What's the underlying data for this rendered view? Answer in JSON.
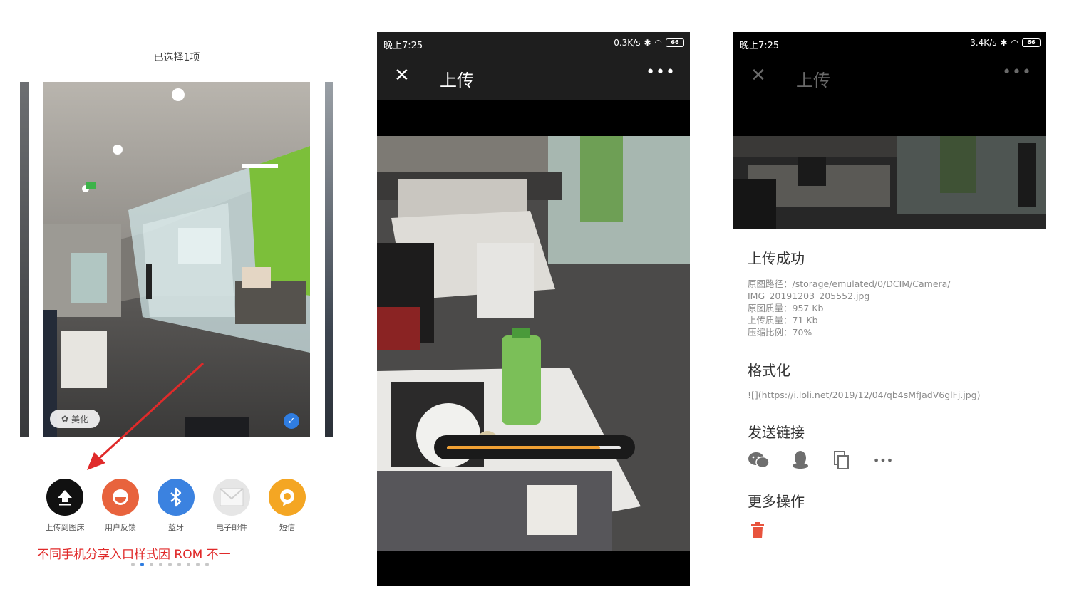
{
  "share_sheet": {
    "title": "已选择1项",
    "beautify_label": "美化",
    "items": [
      {
        "label": "上传到图床",
        "icon": "upload-icon",
        "color": "#111111"
      },
      {
        "label": "用户反馈",
        "icon": "feedback-icon",
        "color": "#e8633d"
      },
      {
        "label": "蓝牙",
        "icon": "bluetooth-icon",
        "color": "#3b82e0"
      },
      {
        "label": "电子邮件",
        "icon": "email-icon",
        "color": "#e6e6e6"
      },
      {
        "label": "短信",
        "icon": "sms-icon",
        "color": "#f4a623"
      }
    ],
    "note": "不同手机分享入口样式因 ROM 不一",
    "page_dots": 9,
    "active_dot": 1
  },
  "upload_screen": {
    "status": {
      "time": "晚上7:25",
      "speed": "0.3K/s",
      "battery": "66"
    },
    "title": "上传",
    "close_icon": "close-icon",
    "more_icon": "more-icon",
    "progress": 0.88,
    "progress_color": "#f0a033"
  },
  "result_screen": {
    "status": {
      "time": "晚上7:25",
      "speed": "3.4K/s",
      "battery": "66"
    },
    "title": "上传",
    "success_title": "上传成功",
    "info": {
      "path_label": "原图路径：",
      "path_value_1": "/storage/emulated/0/DCIM/Camera/",
      "path_value_2": "IMG_20191203_205552.jpg",
      "orig_size": "原图质量：957 Kb",
      "upload_size": "上传质量：71 Kb",
      "ratio": "压缩比例：70%"
    },
    "format_title": "格式化",
    "format_value": "![](https://i.loli.net/2019/12/04/qb4sMfJadV6glFj.jpg)",
    "send_title": "发送链接",
    "send_icons": [
      "wechat-icon",
      "qq-icon",
      "copy-icon",
      "more-icon"
    ],
    "more_ops_title": "更多操作",
    "delete_icon": "trash-icon",
    "delete_color": "#e8533d"
  }
}
